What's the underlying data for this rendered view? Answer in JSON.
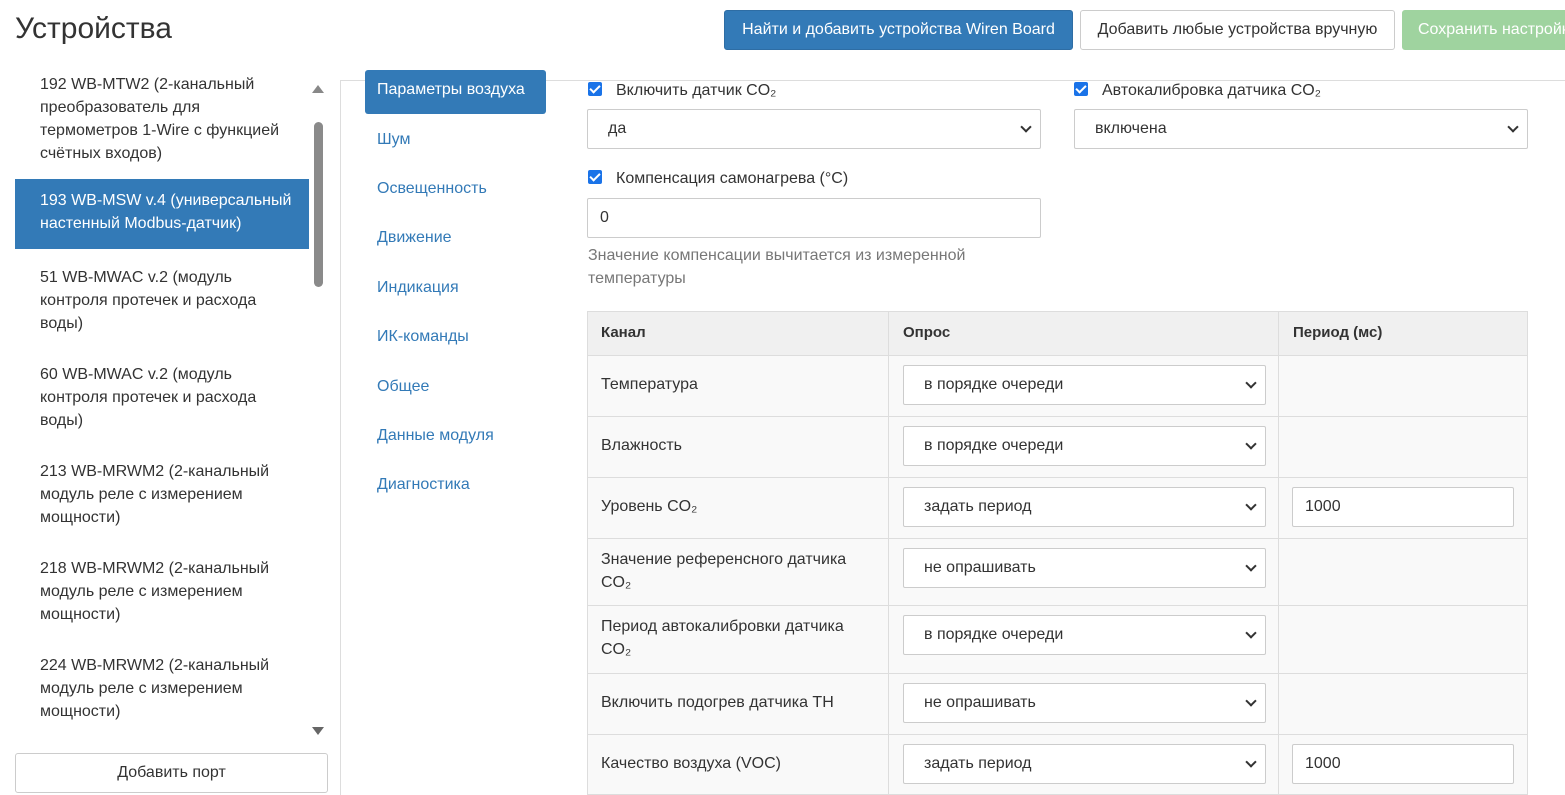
{
  "header": {
    "title": "Устройства",
    "find_button": "Найти и добавить устройства Wiren Board",
    "add_manual_button": "Добавить любые устройства вручную",
    "save_button": "Сохранить настройки"
  },
  "sidebar": {
    "devices": [
      {
        "label": "192 WB-MTW2 (2-канальный преобразователь для термометров 1-Wire с функцией счётных входов)",
        "active": false
      },
      {
        "label": "193 WB-MSW v.4 (универсальный настенный Modbus-датчик)",
        "active": true
      },
      {
        "label": "51 WB-MWAC v.2 (модуль контроля протечек и расхода воды)",
        "active": false
      },
      {
        "label": "60 WB-MWAC v.2 (модуль контроля протечек и расхода воды)",
        "active": false
      },
      {
        "label": "213 WB-MRWM2 (2-канальный модуль реле с измерением мощности)",
        "active": false
      },
      {
        "label": "218 WB-MRWM2 (2-канальный модуль реле с измерением мощности)",
        "active": false
      },
      {
        "label": "224 WB-MRWM2 (2-канальный модуль реле с измерением мощности)",
        "active": false
      }
    ],
    "add_port": "Добавить порт"
  },
  "tabs": [
    {
      "label": "Параметры воздуха",
      "active": true
    },
    {
      "label": "Шум",
      "active": false
    },
    {
      "label": "Освещенность",
      "active": false
    },
    {
      "label": "Движение",
      "active": false
    },
    {
      "label": "Индикация",
      "active": false
    },
    {
      "label": "ИК-команды",
      "active": false
    },
    {
      "label": "Общее",
      "active": false
    },
    {
      "label": "Данные модуля",
      "active": false
    },
    {
      "label": "Диагностика",
      "active": false
    }
  ],
  "form": {
    "co2_enable": {
      "label": "Включить датчик CO₂",
      "checked": true,
      "value": "да"
    },
    "co2_autocal": {
      "label": "Автокалибровка датчика CO₂",
      "checked": true,
      "value": "включена"
    },
    "self_heat": {
      "label": "Компенсация самонагрева (°C)",
      "checked": true,
      "value": "0"
    },
    "self_heat_help": "Значение компенсации вычитается из измеренной температуры"
  },
  "table": {
    "headers": [
      "Канал",
      "Опрос",
      "Период (мс)"
    ],
    "rows": [
      {
        "channel": "Температура",
        "poll": "в порядке очереди",
        "period": ""
      },
      {
        "channel": "Влажность",
        "poll": "в порядке очереди",
        "period": ""
      },
      {
        "channel": "Уровень CO₂",
        "poll": "задать период",
        "period": "1000"
      },
      {
        "channel": "Значение референсного датчика CO₂",
        "poll": "не опрашивать",
        "period": ""
      },
      {
        "channel": "Период автокалибровки датчика CO₂",
        "poll": "в порядке очереди",
        "period": ""
      },
      {
        "channel": "Включить подогрев датчика TH",
        "poll": "не опрашивать",
        "period": ""
      },
      {
        "channel": "Качество воздуха (VOC)",
        "poll": "задать период",
        "period": "1000"
      }
    ]
  },
  "colors": {
    "primary": "#337ab7",
    "success_disabled": "#9fd39f",
    "checkbox": "#1a73e8"
  }
}
